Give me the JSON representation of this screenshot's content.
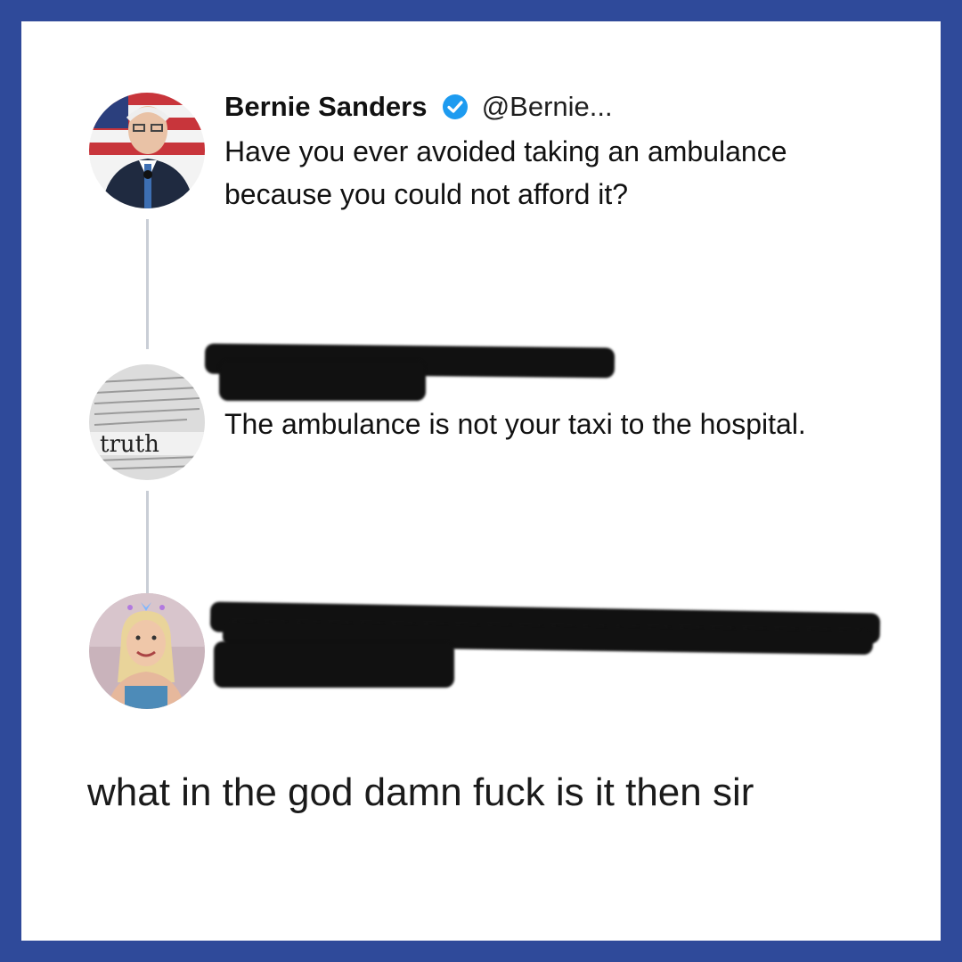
{
  "tweets": [
    {
      "name": "Bernie Sanders",
      "handle": "@Bernie...",
      "verified": true,
      "text": "Have you ever avoided taking an ambulance because you could not afford it?",
      "avatar": "bernie-sanders-photo"
    },
    {
      "name": "",
      "handle": "",
      "redacted": true,
      "text": "The ambulance is not your taxi to the hospital.",
      "avatar": "newspaper-truth-photo",
      "avatar_label": "truth"
    },
    {
      "name": "",
      "handle": "",
      "redacted": true,
      "text": "",
      "avatar": "woman-photo"
    }
  ],
  "caption": "what in the god damn fuck is it then sir",
  "colors": {
    "border": "#2f4a9a",
    "verified": "#1d9bf0",
    "redaction": "#111111",
    "thread_line": "#c9ced6"
  }
}
